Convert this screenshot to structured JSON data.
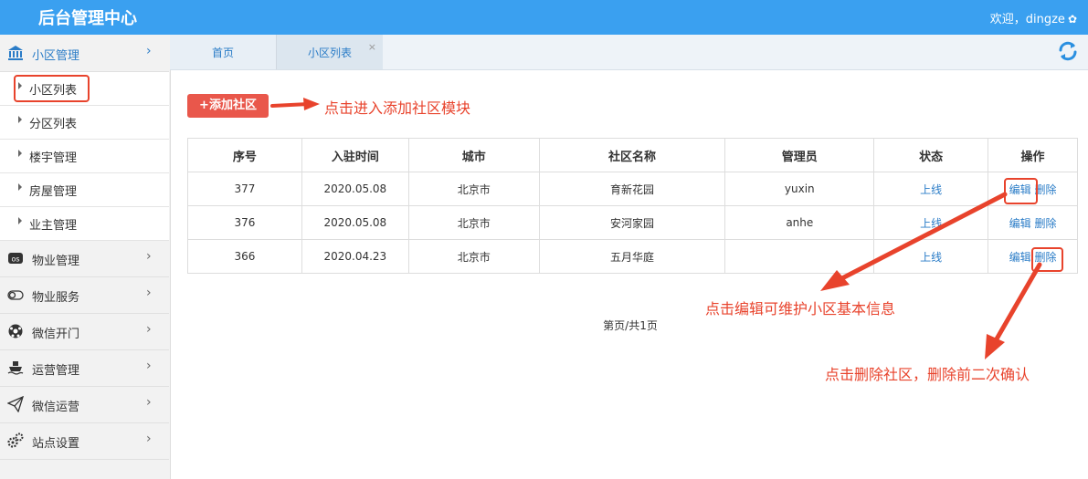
{
  "header": {
    "title": "后台管理中心",
    "welcome": "欢迎，dingze"
  },
  "sidebar": {
    "menus": [
      {
        "label": "小区管理",
        "icon": "bank-icon"
      },
      {
        "label": "物业管理",
        "icon": "os-icon"
      },
      {
        "label": "物业服务",
        "icon": "toggle-icon"
      },
      {
        "label": "微信开门",
        "icon": "soccer-ball-icon"
      },
      {
        "label": "运营管理",
        "icon": "ship-icon"
      },
      {
        "label": "微信运营",
        "icon": "paper-plane-icon"
      },
      {
        "label": "站点设置",
        "icon": "cogs-icon"
      }
    ],
    "sub_items": [
      "小区列表",
      "分区列表",
      "楼宇管理",
      "房屋管理",
      "业主管理"
    ]
  },
  "tabs": {
    "home": "首页",
    "current": "小区列表",
    "close": "×"
  },
  "toolbar": {
    "add_button": "+添加社区"
  },
  "table": {
    "headers": [
      "序号",
      "入驻时间",
      "城市",
      "社区名称",
      "管理员",
      "状态",
      "操作"
    ],
    "rows": [
      {
        "id": "377",
        "date": "2020.05.08",
        "city": "北京市",
        "name": "育新花园",
        "admin": "yuxin",
        "status": "上线",
        "edit": "编辑",
        "del": "删除"
      },
      {
        "id": "376",
        "date": "2020.05.08",
        "city": "北京市",
        "name": "安河家园",
        "admin": "anhe",
        "status": "上线",
        "edit": "编辑",
        "del": "删除"
      },
      {
        "id": "366",
        "date": "2020.04.23",
        "city": "北京市",
        "name": "五月华庭",
        "admin": "",
        "status": "上线",
        "edit": "编辑",
        "del": "删除"
      }
    ]
  },
  "pager": "第页/共1页",
  "annotations": {
    "add": "点击进入添加社区模块",
    "edit": "点击编辑可维护小区基本信息",
    "del": "点击删除社区，删除前二次确认"
  },
  "colors": {
    "header": "#3aa0f0",
    "accent": "#2a7cc7",
    "button": "#e9574b",
    "annotation": "#e8432c"
  }
}
